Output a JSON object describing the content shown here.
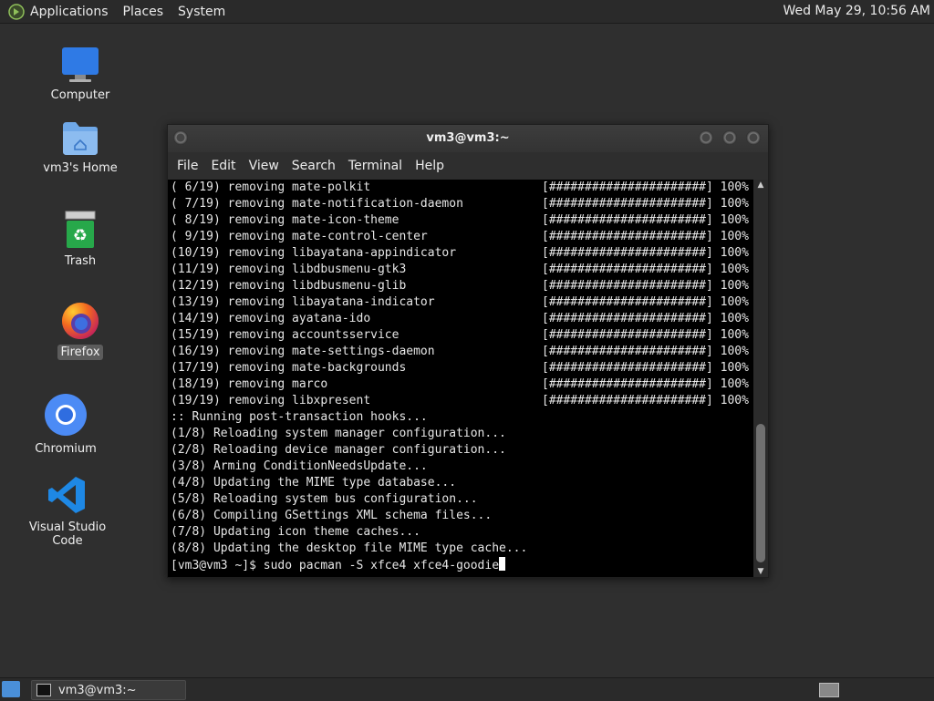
{
  "top_panel": {
    "menus": [
      "Applications",
      "Places",
      "System"
    ],
    "clock": "Wed May 29, 10:56 AM"
  },
  "desktop_icons": [
    {
      "label": "Computer",
      "icon": "computer-icon"
    },
    {
      "label": "vm3's Home",
      "icon": "home-folder-icon"
    },
    {
      "label": "Trash",
      "icon": "trash-icon"
    },
    {
      "label": "Firefox",
      "icon": "firefox-icon",
      "selected": true
    },
    {
      "label": "Chromium",
      "icon": "chromium-icon"
    },
    {
      "label": "Visual Studio Code",
      "icon": "vscode-icon"
    }
  ],
  "terminal": {
    "title": "vm3@vm3:~",
    "menu": [
      "File",
      "Edit",
      "View",
      "Search",
      "Terminal",
      "Help"
    ],
    "lines": [
      "( 6/19) removing mate-polkit                        [######################] 100%",
      "( 7/19) removing mate-notification-daemon           [######################] 100%",
      "( 8/19) removing mate-icon-theme                    [######################] 100%",
      "( 9/19) removing mate-control-center                [######################] 100%",
      "(10/19) removing libayatana-appindicator            [######################] 100%",
      "(11/19) removing libdbusmenu-gtk3                   [######################] 100%",
      "(12/19) removing libdbusmenu-glib                   [######################] 100%",
      "(13/19) removing libayatana-indicator               [######################] 100%",
      "(14/19) removing ayatana-ido                        [######################] 100%",
      "(15/19) removing accountsservice                    [######################] 100%",
      "(16/19) removing mate-settings-daemon               [######################] 100%",
      "(17/19) removing mate-backgrounds                   [######################] 100%",
      "(18/19) removing marco                              [######################] 100%",
      "(19/19) removing libxpresent                        [######################] 100%",
      ":: Running post-transaction hooks...",
      "(1/8) Reloading system manager configuration...",
      "(2/8) Reloading device manager configuration...",
      "(3/8) Arming ConditionNeedsUpdate...",
      "(4/8) Updating the MIME type database...",
      "(5/8) Reloading system bus configuration...",
      "(6/8) Compiling GSettings XML schema files...",
      "(7/8) Updating icon theme caches...",
      "(8/8) Updating the desktop file MIME type cache..."
    ],
    "prompt": "[vm3@vm3 ~]$ sudo pacman -S xfce4 xfce4-goodie"
  },
  "taskbar": {
    "task_label": "vm3@vm3:~"
  }
}
